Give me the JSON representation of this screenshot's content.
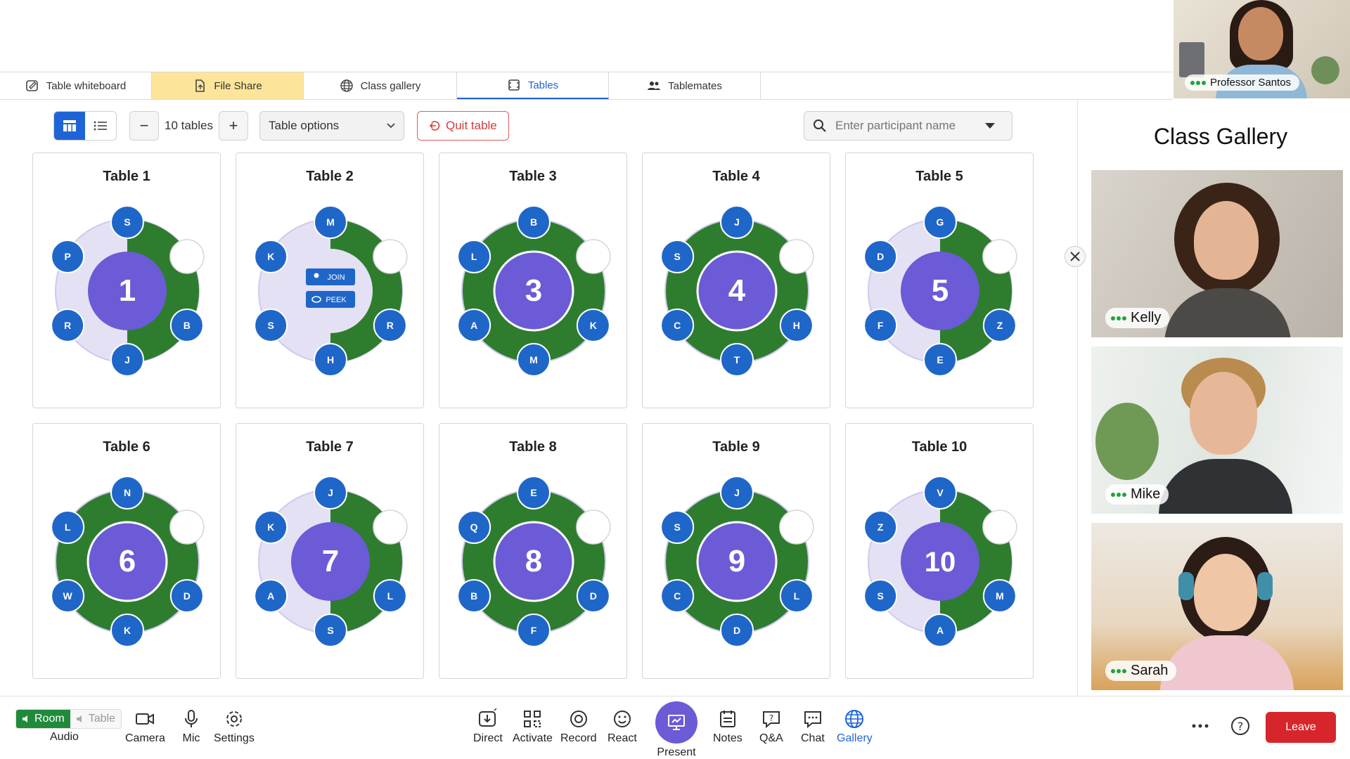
{
  "tabs": [
    {
      "label": "Table whiteboard",
      "icon": "whiteboard-icon"
    },
    {
      "label": "File Share",
      "icon": "file-share-icon"
    },
    {
      "label": "Class gallery",
      "icon": "globe-icon"
    },
    {
      "label": "Tables",
      "icon": "tables-icon"
    },
    {
      "label": "Tablemates",
      "icon": "people-icon"
    }
  ],
  "professor": {
    "name": "Professor Santos"
  },
  "toolbar": {
    "table_count": "10 tables",
    "minus": "−",
    "plus": "+",
    "table_options": "Table options",
    "quit_table": "Quit table"
  },
  "search": {
    "placeholder": "Enter participant name"
  },
  "tables": [
    {
      "title": "Table 1",
      "number": "1",
      "seats": [
        "S",
        "",
        "B",
        "J",
        "R",
        "P"
      ],
      "style": "half"
    },
    {
      "title": "Table 2",
      "number": "",
      "seats": [
        "M",
        "",
        "R",
        "H",
        "S",
        "K"
      ],
      "style": "half",
      "actions": {
        "join": "JOIN",
        "peek": "PEEK"
      }
    },
    {
      "title": "Table 3",
      "number": "3",
      "seats": [
        "B",
        "",
        "K",
        "M",
        "A",
        "L"
      ],
      "style": "full"
    },
    {
      "title": "Table 4",
      "number": "4",
      "seats": [
        "J",
        "",
        "H",
        "T",
        "C",
        "S"
      ],
      "style": "full"
    },
    {
      "title": "Table 5",
      "number": "5",
      "seats": [
        "G",
        "",
        "Z",
        "E",
        "F",
        "D"
      ],
      "style": "half"
    },
    {
      "title": "Table 6",
      "number": "6",
      "seats": [
        "N",
        "",
        "D",
        "K",
        "W",
        "L"
      ],
      "style": "full"
    },
    {
      "title": "Table 7",
      "number": "7",
      "seats": [
        "J",
        "",
        "L",
        "S",
        "A",
        "K"
      ],
      "style": "half"
    },
    {
      "title": "Table 8",
      "number": "8",
      "seats": [
        "E",
        "",
        "D",
        "F",
        "B",
        "Q"
      ],
      "style": "full"
    },
    {
      "title": "Table 9",
      "number": "9",
      "seats": [
        "J",
        "",
        "L",
        "D",
        "C",
        "S"
      ],
      "style": "full"
    },
    {
      "title": "Table 10",
      "number": "10",
      "seats": [
        "V",
        "",
        "M",
        "A",
        "S",
        "Z"
      ],
      "style": "half"
    }
  ],
  "gallery": {
    "title": "Class Gallery",
    "participants": [
      {
        "name": "Kelly"
      },
      {
        "name": "Mike"
      },
      {
        "name": "Sarah"
      }
    ]
  },
  "audio": {
    "label": "Audio",
    "room": "Room",
    "table": "Table"
  },
  "bottom": {
    "camera": "Camera",
    "mic": "Mic",
    "settings": "Settings",
    "direct": "Direct",
    "activate": "Activate",
    "record": "Record",
    "react": "React",
    "present": "Present",
    "notes": "Notes",
    "qa": "Q&A",
    "chat": "Chat",
    "gallery": "Gallery",
    "leave": "Leave"
  },
  "colors": {
    "accent": "#1e64d6",
    "table_green": "#2e7d2e",
    "table_lavender": "#e4e1f5",
    "table_center": "#6b5bd6",
    "seat_blue": "#1f66c9",
    "leave_red": "#d7262b",
    "highlight_tab": "#fce59a"
  }
}
